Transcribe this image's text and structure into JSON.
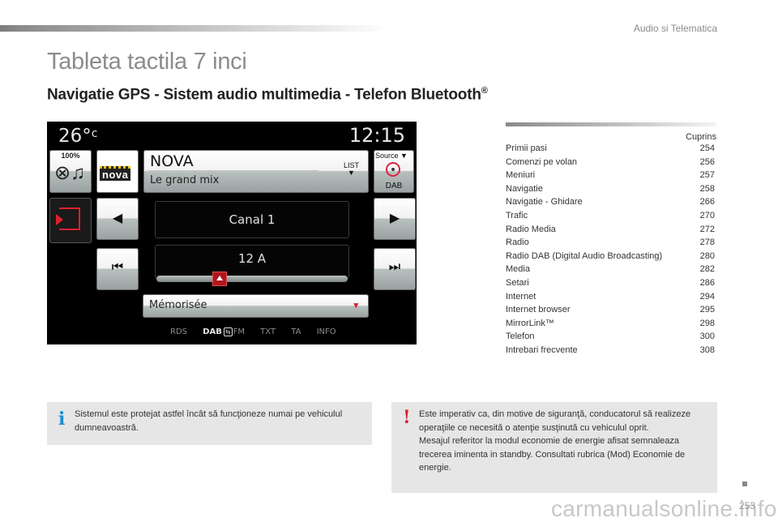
{
  "header": {
    "section": "Audio si Telematica",
    "title": "Tableta tactila 7 inci",
    "subtitle": "Navigatie GPS - Sistem audio multimedia - Telefon Bluetooth",
    "subtitle_mark": "®"
  },
  "screen": {
    "temperature": "26°",
    "temperature_unit": "c",
    "clock": "12:15",
    "volume_label": "100%",
    "volume_icon": "music-mute-icon",
    "station_logo": "nova",
    "station_name": "NOVA",
    "station_subtitle": "Le grand mix",
    "list_label": "LIST",
    "source_label": "Source ▼",
    "source_value": "DAB",
    "exit_icon": "exit-icon",
    "prev_glyph": "◀",
    "next_glyph": "▶",
    "skip_back_glyph": "⏮",
    "skip_fwd_glyph": "⏭",
    "channel": "Canal 1",
    "frequency": "12 A",
    "slider_position": 0.33,
    "preset_label": "Mémorisée",
    "options": [
      "RDS",
      "DAB",
      "FM",
      "TXT",
      "TA",
      "INFO"
    ],
    "active_option": "DAB",
    "colors": {
      "accent": "#e0202b",
      "screen_bg": "#000000"
    }
  },
  "toc": {
    "heading": "Cuprins",
    "items": [
      {
        "label": "Primii pasi",
        "page": "254"
      },
      {
        "label": "Comenzi pe volan",
        "page": "256"
      },
      {
        "label": "Meniuri",
        "page": "257"
      },
      {
        "label": "Navigatie",
        "page": "258"
      },
      {
        "label": "Navigatie - Ghidare",
        "page": "266"
      },
      {
        "label": "Trafic",
        "page": "270"
      },
      {
        "label": "Radio Media",
        "page": "272"
      },
      {
        "label": "Radio",
        "page": "278"
      },
      {
        "label": "Radio DAB (Digital Audio Broadcasting)",
        "page": "280"
      },
      {
        "label": "Media",
        "page": "282"
      },
      {
        "label": "Setari",
        "page": "286"
      },
      {
        "label": "Internet",
        "page": "294"
      },
      {
        "label": "Internet browser",
        "page": "295"
      },
      {
        "label": "MirrorLink™",
        "page": "298"
      },
      {
        "label": "Telefon",
        "page": "300"
      },
      {
        "label": "Intrebari frecvente",
        "page": "308"
      }
    ]
  },
  "notes": {
    "info": {
      "icon": "i",
      "text": "Sistemul este protejat astfel încât să funcţioneze numai pe vehiculul dumneavoastră."
    },
    "warning": {
      "icon": "!",
      "text_1": "Este imperativ ca, din motive de siguranţă, conducatorul să realizeze operaţiile ce necesită o atenţie susţinută cu vehiculul oprit.",
      "text_2": "Mesajul referitor la modul economie de energie afisat semnaleaza trecerea iminenta in standby. Consultati rubrica (Mod) Economie de energie."
    },
    "colors": {
      "info": "#1b8fce",
      "warning": "#e0202b",
      "background": "#e6e6e7"
    }
  },
  "footer": {
    "page_number": "253",
    "watermark": "carmanualsonline.info"
  }
}
